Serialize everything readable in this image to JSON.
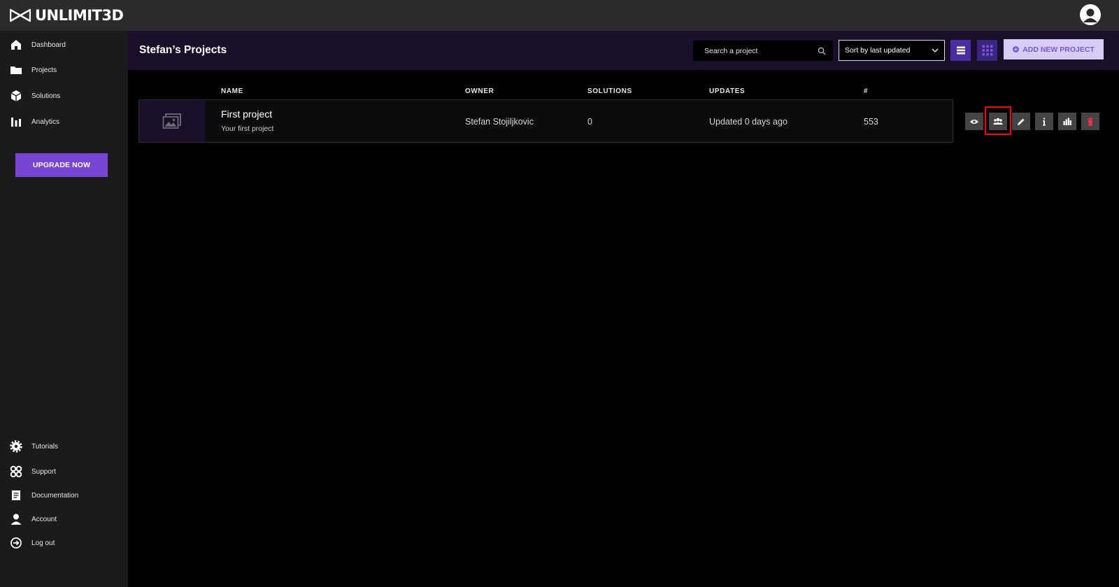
{
  "app": {
    "logo_text": "UNLIMIT3D"
  },
  "sidebar": {
    "items": [
      {
        "label": "Dashboard",
        "icon": "home-icon"
      },
      {
        "label": "Projects",
        "icon": "folder-icon"
      },
      {
        "label": "Solutions",
        "icon": "cube-icon"
      },
      {
        "label": "Analytics",
        "icon": "bar-chart-icon"
      }
    ],
    "upgrade_label": "UPGRADE NOW",
    "bottom_items": [
      {
        "label": "Tutorials",
        "icon": "gear-icon"
      },
      {
        "label": "Support",
        "icon": "support-icon"
      },
      {
        "label": "Documentation",
        "icon": "document-icon"
      },
      {
        "label": "Account",
        "icon": "user-icon"
      },
      {
        "label": "Log out",
        "icon": "logout-icon"
      }
    ]
  },
  "header": {
    "title": "Stefan’s Projects",
    "search_placeholder": "Search a project",
    "sort_label": "Sort by last updated",
    "add_label": "ADD NEW PROJECT"
  },
  "table": {
    "columns": [
      "NAME",
      "OWNER",
      "SOLUTIONS",
      "UPDATES",
      "#"
    ],
    "rows": [
      {
        "name": "First project",
        "description": "Your first project",
        "owner": "Stefan Stojiljkovic",
        "solutions": "0",
        "updates": "Updated 0 days ago",
        "number": "553"
      }
    ]
  },
  "actions": [
    "eye-icon",
    "users-icon",
    "pencil-icon",
    "info-icon",
    "bar-chart-icon",
    "trash-icon"
  ],
  "colors": {
    "accent": "#7845d3",
    "header_bg": "#1a0f2b",
    "sidebar_bg": "#1b1b1d",
    "topbar_bg": "#2b2b2d",
    "delete": "#e0314b",
    "highlight": "#ff0000"
  }
}
